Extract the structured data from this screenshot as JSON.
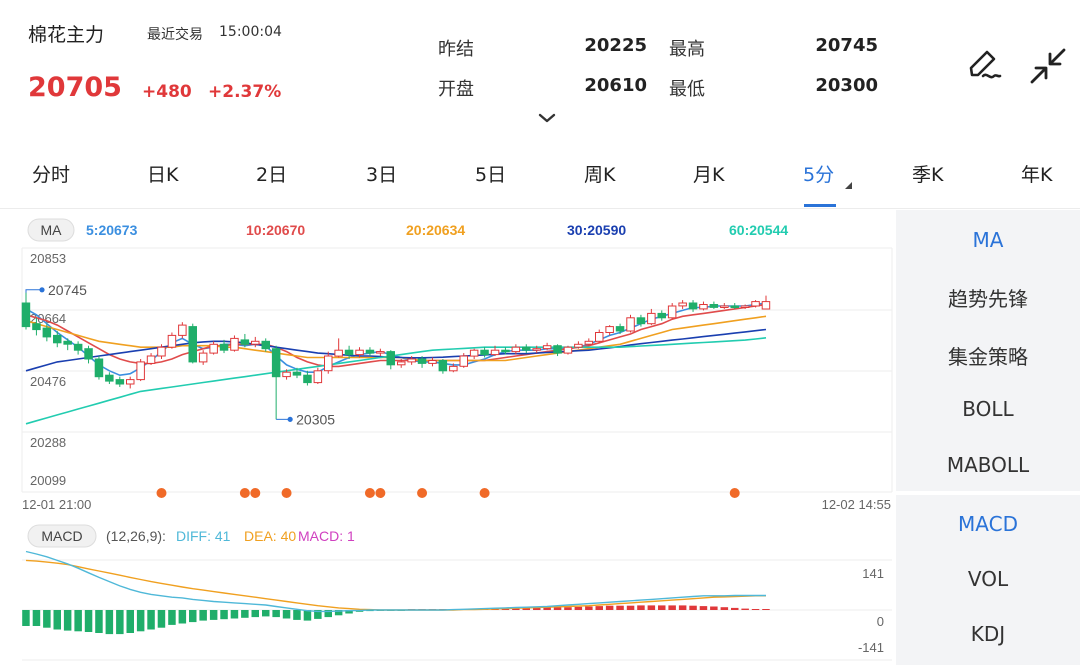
{
  "header": {
    "name": "棉花主力",
    "trade_label": "最近交易",
    "trade_time": "15:00:04",
    "price": "20705",
    "change": "+480",
    "change_pct": "+2.37%",
    "quotes": [
      {
        "label": "昨结",
        "value": "20225"
      },
      {
        "label": "最高",
        "value": "20745"
      },
      {
        "label": "开盘",
        "value": "20610"
      },
      {
        "label": "最低",
        "value": "20300"
      }
    ]
  },
  "tabs": [
    {
      "label": "分时"
    },
    {
      "label": "日K"
    },
    {
      "label": "2日"
    },
    {
      "label": "3日"
    },
    {
      "label": "5日"
    },
    {
      "label": "周K"
    },
    {
      "label": "月K"
    },
    {
      "label": "5分"
    },
    {
      "label": "季K"
    },
    {
      "label": "年K"
    }
  ],
  "active_tab": "5分",
  "side_panel": {
    "main_indicators": [
      "MA",
      "趋势先锋",
      "集金策略",
      "BOLL",
      "MABOLL"
    ],
    "sub_indicators": [
      "MACD",
      "VOL",
      "KDJ"
    ],
    "active_main": "MA",
    "active_sub": "MACD"
  },
  "colors": {
    "up": "#e0383a",
    "down": "#1fae6a",
    "accent": "#2a73d8",
    "ma5": "#3b8fe0",
    "ma10": "#e04b4b",
    "ma20": "#f0a020",
    "ma30": "#1a3fb0",
    "ma60": "#22ccb0",
    "dif": "#4fb8d8",
    "dea": "#f0a020",
    "macd": "#d040c0",
    "marker": "#f06a28"
  },
  "icons": [
    "pen-icon",
    "collapse-arrows-icon",
    "chevron-down-icon"
  ],
  "chart_data": {
    "type": "candlestick",
    "main": {
      "indicator_badge": "MA",
      "legend": [
        {
          "name": "5",
          "value": "20673"
        },
        {
          "name": "10",
          "value": "20670"
        },
        {
          "name": "20",
          "value": "20634"
        },
        {
          "name": "30",
          "value": "20590"
        },
        {
          "name": "60",
          "value": "20544"
        }
      ],
      "y_ticks": [
        "20853",
        "20664",
        "20476",
        "20288",
        "20099"
      ],
      "ylim": [
        20099,
        20853
      ],
      "x_start_label": "12-01 21:00",
      "x_end_label": "12-02 14:55",
      "high_annotation": "20745",
      "low_annotation": "20305",
      "high_value": 20745,
      "low_value": 20305,
      "high_index": 0,
      "low_index": 24,
      "candles": [
        [
          20700,
          20620,
          20745,
          20610
        ],
        [
          20630,
          20610,
          20650,
          20590
        ],
        [
          20615,
          20585,
          20630,
          20570
        ],
        [
          20590,
          20565,
          20605,
          20550
        ],
        [
          20570,
          20560,
          20580,
          20540
        ],
        [
          20560,
          20540,
          20570,
          20525
        ],
        [
          20545,
          20510,
          20555,
          20495
        ],
        [
          20510,
          20450,
          20520,
          20440
        ],
        [
          20455,
          20435,
          20465,
          20425
        ],
        [
          20440,
          20425,
          20450,
          20415
        ],
        [
          20425,
          20440,
          20450,
          20410
        ],
        [
          20440,
          20500,
          20510,
          20435
        ],
        [
          20495,
          20520,
          20530,
          20490
        ],
        [
          20520,
          20550,
          20560,
          20510
        ],
        [
          20550,
          20590,
          20600,
          20545
        ],
        [
          20590,
          20625,
          20635,
          20580
        ],
        [
          20620,
          20500,
          20630,
          20495
        ],
        [
          20500,
          20530,
          20540,
          20490
        ],
        [
          20530,
          20560,
          20570,
          20525
        ],
        [
          20560,
          20540,
          20575,
          20530
        ],
        [
          20540,
          20580,
          20590,
          20535
        ],
        [
          20575,
          20560,
          20595,
          20550
        ],
        [
          20560,
          20570,
          20585,
          20550
        ],
        [
          20570,
          20545,
          20580,
          20535
        ],
        [
          20545,
          20450,
          20555,
          20305
        ],
        [
          20450,
          20465,
          20475,
          20440
        ],
        [
          20465,
          20455,
          20480,
          20445
        ],
        [
          20455,
          20430,
          20470,
          20420
        ],
        [
          20430,
          20470,
          20480,
          20425
        ],
        [
          20470,
          20520,
          20535,
          20460
        ],
        [
          20520,
          20540,
          20580,
          20515
        ],
        [
          20540,
          20525,
          20555,
          20510
        ],
        [
          20525,
          20540,
          20550,
          20515
        ],
        [
          20540,
          20530,
          20550,
          20520
        ],
        [
          20530,
          20535,
          20545,
          20520
        ],
        [
          20535,
          20490,
          20540,
          20475
        ],
        [
          20490,
          20500,
          20510,
          20480
        ],
        [
          20500,
          20510,
          20520,
          20490
        ],
        [
          20510,
          20495,
          20520,
          20480
        ],
        [
          20495,
          20505,
          20515,
          20485
        ],
        [
          20505,
          20470,
          20510,
          20460
        ],
        [
          20470,
          20485,
          20495,
          20465
        ],
        [
          20485,
          20520,
          20530,
          20480
        ],
        [
          20520,
          20540,
          20545,
          20510
        ],
        [
          20540,
          20525,
          20550,
          20515
        ],
        [
          20525,
          20540,
          20555,
          20520
        ],
        [
          20540,
          20535,
          20550,
          20525
        ],
        [
          20535,
          20550,
          20560,
          20525
        ],
        [
          20550,
          20540,
          20560,
          20530
        ],
        [
          20540,
          20545,
          20555,
          20530
        ],
        [
          20545,
          20555,
          20565,
          20540
        ],
        [
          20555,
          20530,
          20560,
          20520
        ],
        [
          20530,
          20550,
          20555,
          20525
        ],
        [
          20550,
          20560,
          20570,
          20545
        ],
        [
          20560,
          20570,
          20580,
          20555
        ],
        [
          20570,
          20600,
          20610,
          20565
        ],
        [
          20600,
          20620,
          20625,
          20590
        ],
        [
          20620,
          20605,
          20630,
          20595
        ],
        [
          20605,
          20650,
          20660,
          20600
        ],
        [
          20650,
          20630,
          20660,
          20620
        ],
        [
          20630,
          20665,
          20680,
          20625
        ],
        [
          20665,
          20650,
          20675,
          20640
        ],
        [
          20650,
          20690,
          20700,
          20645
        ],
        [
          20690,
          20700,
          20710,
          20680
        ],
        [
          20700,
          20680,
          20710,
          20670
        ],
        [
          20680,
          20695,
          20705,
          20675
        ],
        [
          20695,
          20685,
          20705,
          20680
        ],
        [
          20685,
          20690,
          20700,
          20680
        ],
        [
          20690,
          20685,
          20700,
          20680
        ],
        [
          20685,
          20690,
          20695,
          20680
        ],
        [
          20690,
          20705,
          20710,
          20685
        ],
        [
          20680,
          20705,
          20725,
          20680
        ]
      ],
      "ma": {
        "5": [
          20680,
          20660,
          20630,
          20600,
          20575,
          20550,
          20520,
          20490,
          20470,
          20455,
          20460,
          20480,
          20505,
          20535,
          20565,
          20580,
          20560,
          20545,
          20550,
          20560,
          20560,
          20555,
          20560,
          20555,
          20520,
          20490,
          20475,
          20465,
          20465,
          20485,
          20500,
          20515,
          20525,
          20530,
          20535,
          20525,
          20515,
          20505,
          20500,
          20500,
          20495,
          20490,
          20490,
          20500,
          20510,
          20525,
          20535,
          20540,
          20540,
          20540,
          20545,
          20545,
          20545,
          20550,
          20560,
          20575,
          20590,
          20600,
          20615,
          20630,
          20645,
          20655,
          20665,
          20675,
          20685,
          20685,
          20690,
          20690,
          20690,
          20690,
          20695,
          20700
        ],
        "10": [
          20660,
          20650,
          20640,
          20625,
          20605,
          20585,
          20565,
          20545,
          20525,
          20510,
          20500,
          20495,
          20495,
          20500,
          20510,
          20525,
          20535,
          20545,
          20555,
          20555,
          20560,
          20560,
          20560,
          20560,
          20550,
          20535,
          20515,
          20500,
          20490,
          20485,
          20485,
          20490,
          20495,
          20500,
          20505,
          20505,
          20505,
          20505,
          20505,
          20505,
          20505,
          20505,
          20505,
          20505,
          20505,
          20510,
          20515,
          20520,
          20525,
          20530,
          20535,
          20540,
          20545,
          20550,
          20555,
          20565,
          20575,
          20585,
          20595,
          20610,
          20620,
          20630,
          20645,
          20655,
          20660,
          20665,
          20670,
          20675,
          20680,
          20685,
          20690,
          20695
        ],
        "20": [
          20640,
          20630,
          20620,
          20610,
          20600,
          20590,
          20580,
          20570,
          20565,
          20560,
          20555,
          20550,
          20550,
          20550,
          20550,
          20555,
          20555,
          20555,
          20555,
          20550,
          20550,
          20545,
          20540,
          20535,
          20530,
          20525,
          20520,
          20515,
          20515,
          20515,
          20515,
          20515,
          20515,
          20515,
          20515,
          20515,
          20515,
          20510,
          20505,
          20505,
          20505,
          20505,
          20505,
          20505,
          20505,
          20505,
          20505,
          20510,
          20515,
          20520,
          20525,
          20530,
          20535,
          20540,
          20545,
          20550,
          20555,
          20560,
          20570,
          20580,
          20590,
          20600,
          20610,
          20615,
          20620,
          20625,
          20630,
          20635,
          20640,
          20645,
          20650,
          20655
        ],
        "30": [
          20470,
          20480,
          20490,
          20500,
          20505,
          20510,
          20515,
          20520,
          20525,
          20530,
          20535,
          20540,
          20545,
          20550,
          20555,
          20560,
          20565,
          20568,
          20570,
          20570,
          20568,
          20565,
          20560,
          20555,
          20550,
          20545,
          20540,
          20535,
          20530,
          20528,
          20525,
          20523,
          20520,
          20520,
          20518,
          20516,
          20515,
          20514,
          20514,
          20515,
          20516,
          20518,
          20520,
          20522,
          20524,
          20526,
          20528,
          20528,
          20528,
          20530,
          20532,
          20534,
          20536,
          20538,
          20540,
          20544,
          20548,
          20552,
          20558,
          20562,
          20566,
          20570,
          20574,
          20578,
          20582,
          20586,
          20590,
          20594,
          20598,
          20602,
          20606,
          20610
        ],
        "60": [
          20290,
          20300,
          20310,
          20320,
          20330,
          20340,
          20350,
          20360,
          20370,
          20380,
          20390,
          20400,
          20405,
          20410,
          20415,
          20420,
          20425,
          20430,
          20435,
          20440,
          20445,
          20450,
          20455,
          20460,
          20465,
          20470,
          20475,
          20480,
          20485,
          20490,
          20495,
          20500,
          20505,
          20510,
          20515,
          20520,
          20525,
          20530,
          20535,
          20540,
          20542,
          20544,
          20546,
          20548,
          20550,
          20550,
          20550,
          20550,
          20550,
          20550,
          20550,
          20550,
          20550,
          20550,
          20550,
          20550,
          20550,
          20550,
          20552,
          20554,
          20556,
          20558,
          20560,
          20562,
          20564,
          20566,
          20568,
          20570,
          20572,
          20574,
          20578,
          20582
        ]
      },
      "marker_indices": [
        13,
        21,
        22,
        25,
        33,
        34,
        38,
        44,
        68
      ]
    },
    "macd": {
      "badge": "MACD",
      "params": "(12,26,9):",
      "dif_label": "DIFF: 41",
      "dea_label": "DEA: 40",
      "macd_label": "MACD: 1",
      "y_ticks": [
        "141",
        "0",
        "-141"
      ],
      "ylim": [
        -141,
        141
      ],
      "dif": [
        165,
        158,
        150,
        140,
        130,
        118,
        105,
        92,
        80,
        68,
        58,
        50,
        44,
        40,
        36,
        34,
        30,
        27,
        24,
        22,
        20,
        18,
        16,
        14,
        10,
        6,
        2,
        -2,
        -4,
        -4,
        -3,
        -2,
        -1,
        0,
        0,
        0,
        0,
        0,
        0,
        0,
        0,
        1,
        2,
        3,
        4,
        5,
        6,
        7,
        8,
        9,
        10,
        12,
        14,
        16,
        18,
        20,
        22,
        24,
        26,
        28,
        30,
        32,
        34,
        36,
        38,
        40,
        40,
        40,
        41,
        41,
        41,
        41
      ],
      "dea": [
        140,
        138,
        135,
        132,
        128,
        122,
        116,
        110,
        104,
        98,
        92,
        86,
        80,
        75,
        70,
        65,
        60,
        56,
        52,
        48,
        44,
        40,
        36,
        32,
        28,
        24,
        20,
        16,
        12,
        9,
        6,
        4,
        2,
        1,
        0,
        0,
        0,
        0,
        0,
        0,
        0,
        0,
        1,
        1,
        2,
        3,
        4,
        5,
        6,
        7,
        8,
        9,
        10,
        11,
        12,
        14,
        16,
        18,
        20,
        22,
        24,
        26,
        28,
        30,
        32,
        34,
        36,
        37,
        38,
        39,
        40,
        40
      ],
      "hist": [
        -45,
        -45,
        -50,
        -55,
        -58,
        -60,
        -62,
        -65,
        -68,
        -68,
        -65,
        -60,
        -55,
        -50,
        -42,
        -38,
        -34,
        -30,
        -28,
        -26,
        -24,
        -22,
        -20,
        -18,
        -20,
        -24,
        -28,
        -30,
        -25,
        -20,
        -15,
        -10,
        -5,
        -3,
        -2,
        -1,
        -1,
        0,
        0,
        0,
        0,
        1,
        2,
        3,
        4,
        5,
        5,
        6,
        6,
        7,
        7,
        8,
        8,
        9,
        10,
        11,
        12,
        12,
        12,
        13,
        13,
        13,
        13,
        13,
        12,
        11,
        10,
        8,
        6,
        4,
        2,
        1
      ]
    }
  }
}
